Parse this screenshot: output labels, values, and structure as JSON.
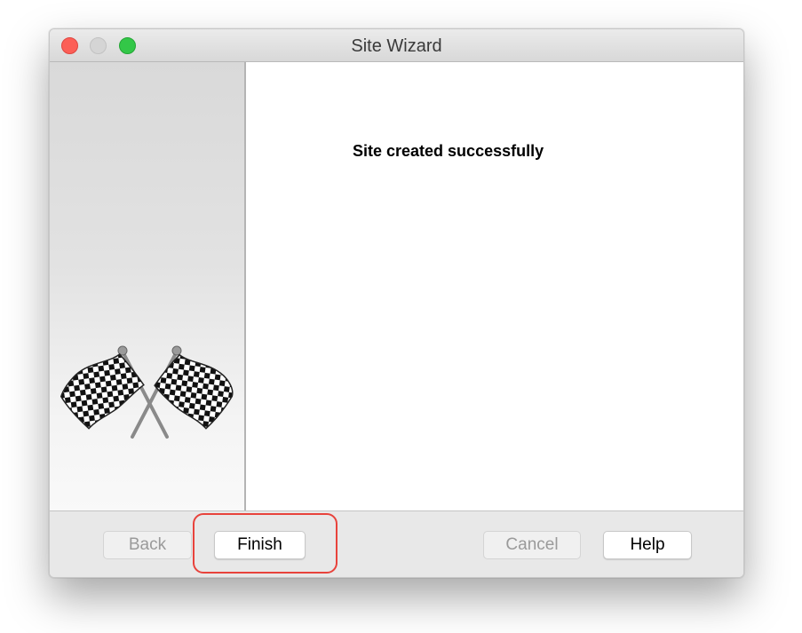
{
  "window": {
    "title": "Site Wizard"
  },
  "sidebar": {
    "image": "checkered-flags-icon"
  },
  "content": {
    "message": "Site created successfully"
  },
  "buttons": {
    "back": "Back",
    "finish": "Finish",
    "cancel": "Cancel",
    "help": "Help"
  },
  "colors": {
    "highlight": "#e8433c",
    "close": "#fc5f57",
    "minimize": "#d5d5d5",
    "zoom": "#33c748"
  }
}
